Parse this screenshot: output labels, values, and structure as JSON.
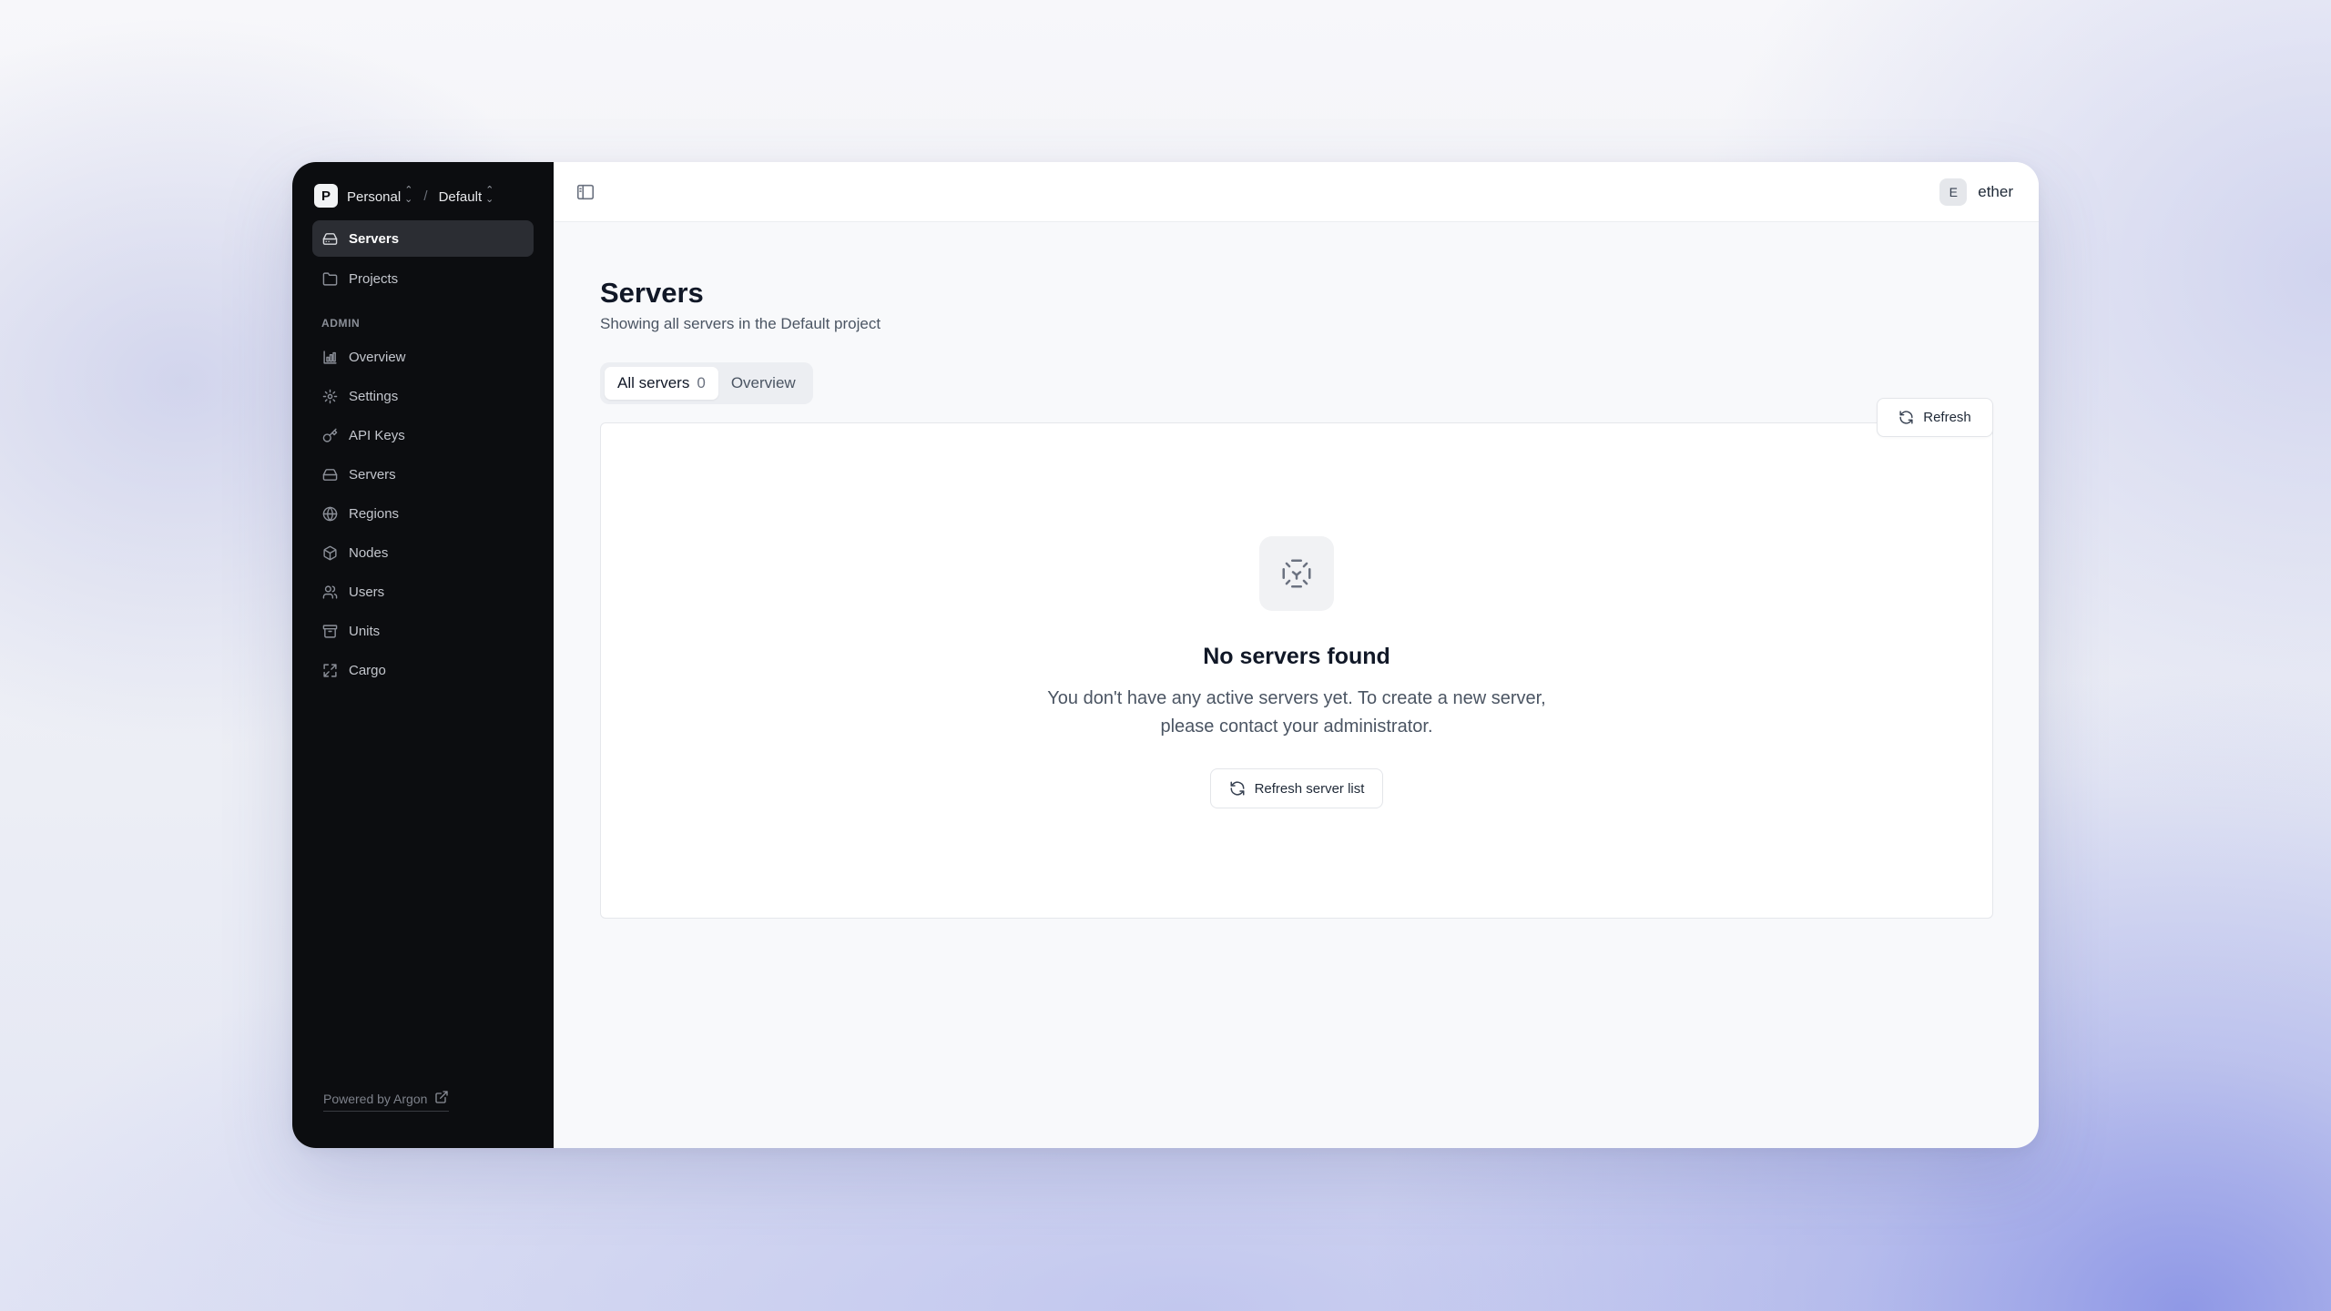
{
  "workspace": {
    "org_initial": "P",
    "org_name": "Personal",
    "separator": "/",
    "project_name": "Default"
  },
  "sidebar": {
    "main_items": [
      {
        "label": "Servers",
        "icon": "server-icon",
        "active": true
      },
      {
        "label": "Projects",
        "icon": "folder-icon",
        "active": false
      }
    ],
    "admin_label": "ADMIN",
    "admin_items": [
      {
        "label": "Overview",
        "icon": "chart-icon"
      },
      {
        "label": "Settings",
        "icon": "gear-icon"
      },
      {
        "label": "API Keys",
        "icon": "key-icon"
      },
      {
        "label": "Servers",
        "icon": "server-icon"
      },
      {
        "label": "Regions",
        "icon": "globe-icon"
      },
      {
        "label": "Nodes",
        "icon": "cube-icon"
      },
      {
        "label": "Users",
        "icon": "users-icon"
      },
      {
        "label": "Units",
        "icon": "archive-icon"
      },
      {
        "label": "Cargo",
        "icon": "expand-icon"
      }
    ],
    "footer": "Powered by Argon"
  },
  "topbar": {
    "user_initial": "E",
    "user_name": "ether"
  },
  "page": {
    "title": "Servers",
    "subtitle": "Showing all servers in the Default project",
    "refresh_label": "Refresh",
    "tabs": [
      {
        "label": "All servers",
        "count": "0",
        "active": true
      },
      {
        "label": "Overview",
        "active": false
      }
    ]
  },
  "empty_state": {
    "title": "No servers found",
    "description": "You don't have any active servers yet. To create a new server, please contact your administrator.",
    "button_label": "Refresh server list"
  }
}
